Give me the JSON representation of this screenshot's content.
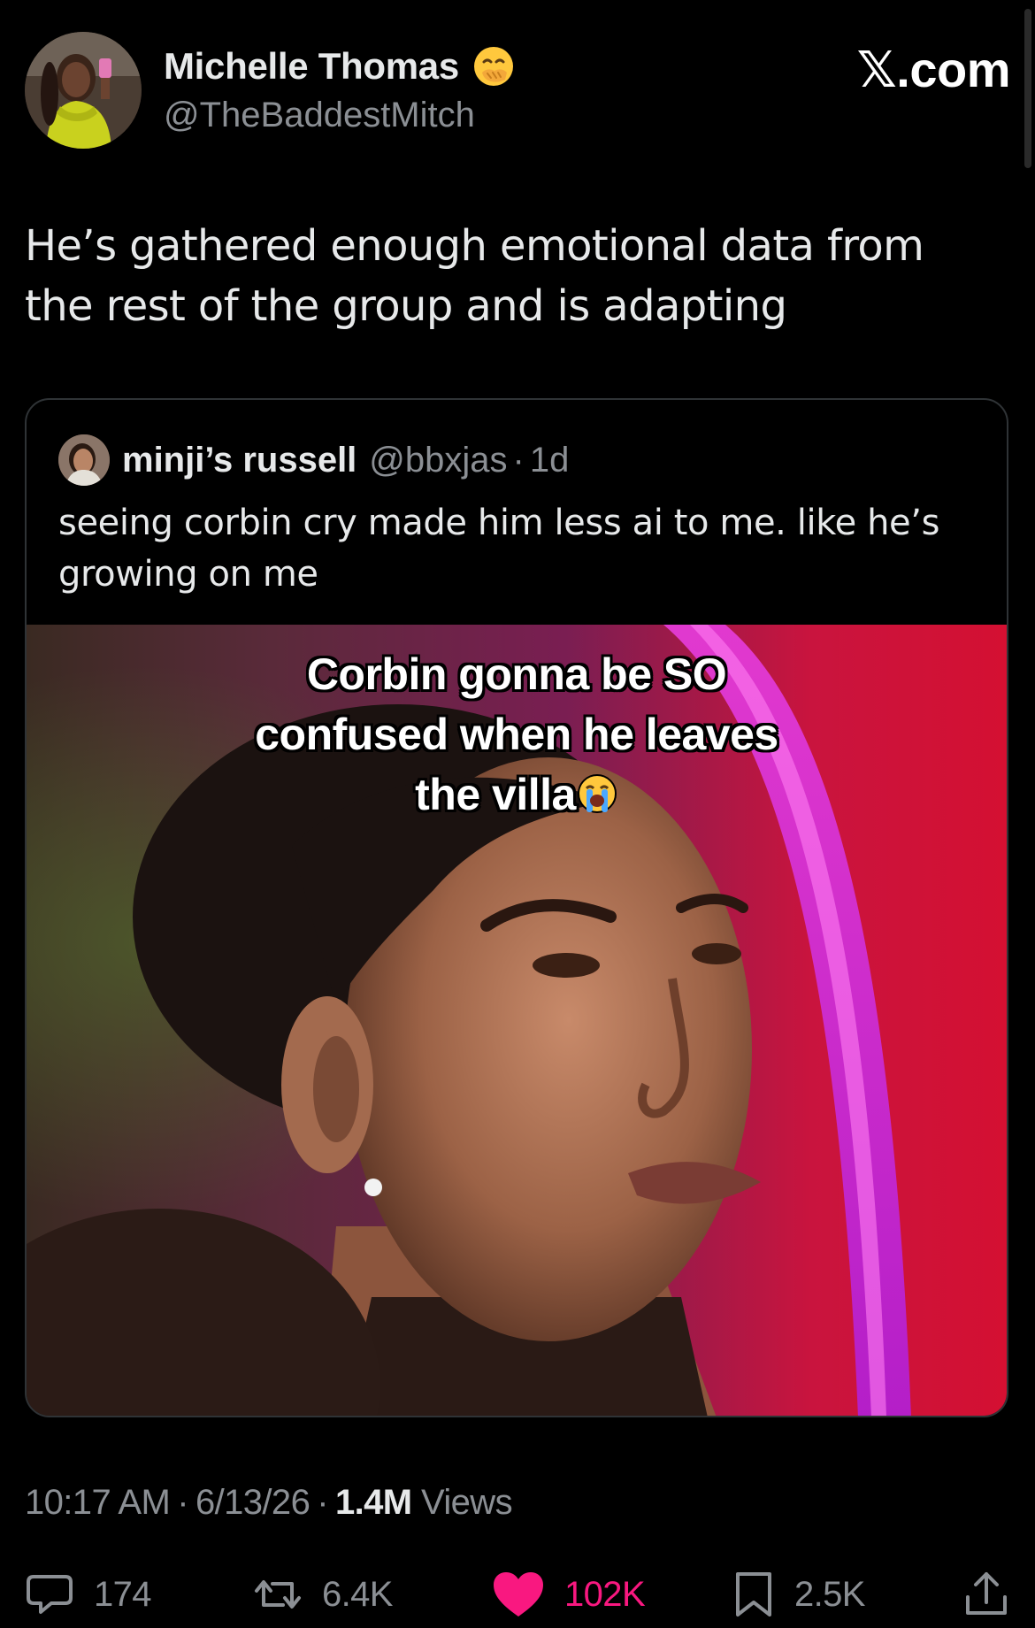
{
  "author": {
    "display_name": "Michelle Thomas",
    "handle": "@TheBaddestMitch",
    "name_emoji": "face-with-hand-over-mouth"
  },
  "brand": {
    "label_suffix": ".com",
    "label_mark": "𝕏"
  },
  "tweet": {
    "text": "He’s gathered enough emotional data from the rest of the group and is adapting"
  },
  "quoted_tweet": {
    "display_name": "minji’s russell",
    "handle": "@bbxjas",
    "separator": "·",
    "age": "1d",
    "text": "seeing corbin cry made him less ai to me. like he’s growing on me",
    "media_caption": {
      "line1": "Corbin gonna be SO",
      "line2": "confused when he leaves",
      "line3": "the villa",
      "emoji": "loudly-crying-face"
    }
  },
  "meta": {
    "time": "10:17 AM",
    "sep1": "·",
    "date": "6/13/26",
    "sep2": "·",
    "views_count": "1.4M",
    "views_label": "Views"
  },
  "actions": {
    "replies": "174",
    "reposts": "6.4K",
    "likes": "102K",
    "bookmarks": "2.5K",
    "like_color": "#f91880",
    "muted_color": "#8b8f94"
  }
}
